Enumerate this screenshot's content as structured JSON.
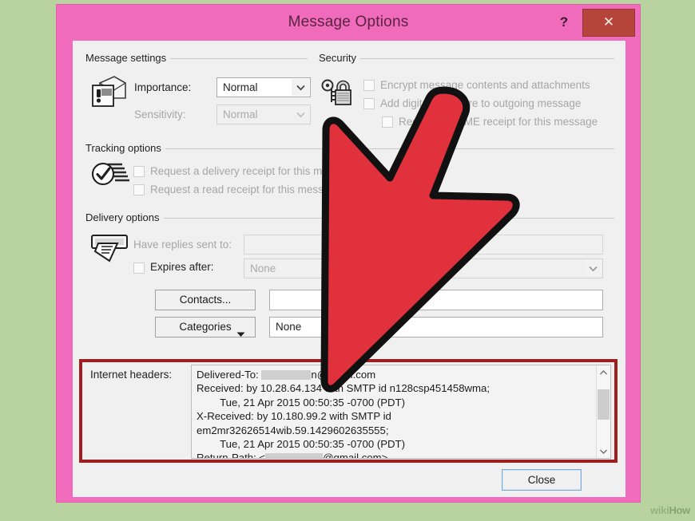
{
  "window": {
    "title": "Message Options",
    "help_label": "?",
    "close_label": "✕",
    "frame_color": "#f06bbb",
    "close_button_color": "#b5453b"
  },
  "message_settings": {
    "legend": "Message settings",
    "icon": "envelope-exclamation-icon",
    "importance_label": "Importance:",
    "importance_value": "Normal",
    "sensitivity_label": "Sensitivity:",
    "sensitivity_value": "Normal"
  },
  "security": {
    "legend": "Security",
    "icon": "padlock-key-icon",
    "checkboxes": [
      {
        "label": "Encrypt message contents and attachments",
        "checked": false
      },
      {
        "label": "Add digital signature to outgoing message",
        "checked": false
      },
      {
        "label": "Request S/MIME receipt for this message",
        "checked": false
      }
    ]
  },
  "tracking_options": {
    "legend": "Tracking options",
    "icon": "checkmark-pages-icon",
    "checkboxes": [
      {
        "label": "Request a delivery receipt for this message",
        "checked": false
      },
      {
        "label": "Request a read receipt for this message",
        "checked": false
      }
    ]
  },
  "delivery_options": {
    "legend": "Delivery options",
    "icon": "mail-slot-hand-icon",
    "have_replies_label": "Have replies sent to:",
    "have_replies_value": "",
    "expires_after_label": "Expires after:",
    "expires_after_checked": false,
    "expires_after_value": "None",
    "contacts_button": "Contacts...",
    "contacts_value": "",
    "categories_button": "Categories",
    "categories_value": "None"
  },
  "internet_headers": {
    "label": "Internet headers:",
    "highlight_color": "#9e1f1f",
    "lines": [
      {
        "prefix": "Delivered-To: ",
        "redact": 62,
        "suffix": "n@gmail.com"
      },
      {
        "prefix": "Received: by 10.28.64.134 with SMTP id n128csp451458wma;",
        "redact": 0,
        "suffix": ""
      },
      {
        "prefix": "        Tue, 21 Apr 2015 00:50:35 -0700 (PDT)",
        "redact": 0,
        "suffix": ""
      },
      {
        "prefix": "X-Received: by 10.180.99.2 with SMTP id",
        "redact": 0,
        "suffix": ""
      },
      {
        "prefix": "em2mr32626514wib.59.1429602635555;",
        "redact": 0,
        "suffix": ""
      },
      {
        "prefix": "        Tue, 21 Apr 2015 00:50:35 -0700 (PDT)",
        "redact": 0,
        "suffix": ""
      },
      {
        "prefix": "Return-Path: <",
        "redact": 72,
        "suffix": "@gmail.com>"
      }
    ],
    "scrollbar_up": "▲",
    "scrollbar_down": "▼"
  },
  "footer": {
    "close_label": "Close"
  },
  "overlay": {
    "arrow_color": "#e0313c",
    "arrow_outline": "#111111",
    "arrow_name": "red-pointer-arrow"
  },
  "watermark": {
    "part1": "wiki",
    "part2": "How"
  }
}
